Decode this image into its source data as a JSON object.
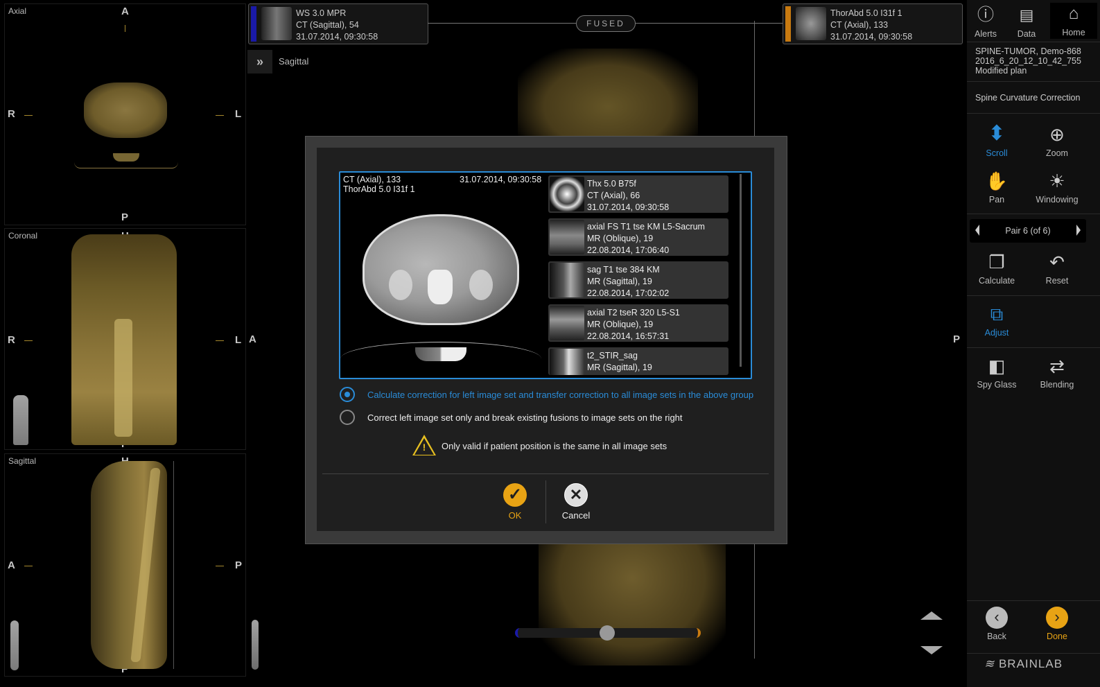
{
  "left_views": {
    "axial": {
      "title": "Axial",
      "top": "A",
      "bottom": "P",
      "left": "R",
      "right": "L"
    },
    "coronal": {
      "title": "Coronal",
      "top": "H",
      "bottom": "F",
      "left": "R",
      "right": "L"
    },
    "sagittal": {
      "title": "Sagittal",
      "top": "H",
      "bottom": "F",
      "left": "A",
      "right": "P"
    }
  },
  "center": {
    "left_series": {
      "line1": "WS 3.0 MPR",
      "line2": "CT (Sagittal), 54",
      "line3": "31.07.2014, 09:30:58",
      "stripe_color": "#1a1aa8"
    },
    "right_series": {
      "line1": "ThorAbd 5.0 I31f 1",
      "line2": "CT (Axial), 133",
      "line3": "31.07.2014, 09:30:58",
      "stripe_color": "#c87a10"
    },
    "fused_label": "FUSED",
    "view_label": "Sagittal",
    "left_ori": "A",
    "right_ori": "P"
  },
  "right_panel": {
    "top_buttons": [
      {
        "label": "Alerts",
        "icon": "info-icon"
      },
      {
        "label": "Data",
        "icon": "data-icon"
      },
      {
        "label": "Home",
        "icon": "home-icon"
      }
    ],
    "patient": {
      "line1": "SPINE-TUMOR, Demo-868",
      "line2": "2016_6_20_12_10_42_755",
      "line3": "Modified plan"
    },
    "section_title": "Spine Curvature Correction",
    "tools": [
      {
        "label": "Scroll",
        "icon": "scroll-icon",
        "active": true
      },
      {
        "label": "Zoom",
        "icon": "zoom-icon"
      },
      {
        "label": "Pan",
        "icon": "pan-hand-icon"
      },
      {
        "label": "Windowing",
        "icon": "windowing-icon"
      }
    ],
    "pair_label": "Pair 6 (of 6)",
    "actions": [
      {
        "label": "Calculate",
        "icon": "calculate-icon"
      },
      {
        "label": "Reset",
        "icon": "reset-icon"
      },
      {
        "label": "Adjust",
        "icon": "adjust-icon",
        "active": true
      },
      {
        "label": "Spy Glass",
        "icon": "spy-glass-icon"
      },
      {
        "label": "Blending",
        "icon": "blending-icon"
      }
    ],
    "back_label": "Back",
    "done_label": "Done",
    "brand": "BRAINLAB",
    "accent_color": "#2a8cd8",
    "done_color": "#e8a314"
  },
  "dialog": {
    "preview_header_left1": "CT (Axial), 133",
    "preview_header_left2": "ThorAbd 5.0 I31f 1",
    "preview_header_right": "31.07.2014, 09:30:58",
    "series_list": [
      {
        "l1": "Thx 5.0 B75f",
        "l2": "CT (Axial), 66",
        "l3": "31.07.2014, 09:30:58"
      },
      {
        "l1": "axial FS T1 tse KM L5-Sacrum",
        "l2": "MR (Oblique), 19",
        "l3": "22.08.2014, 17:06:40"
      },
      {
        "l1": "sag T1 tse 384 KM",
        "l2": "MR (Sagittal), 19",
        "l3": "22.08.2014, 17:02:02"
      },
      {
        "l1": "axial T2 tseR 320 L5-S1",
        "l2": "MR (Oblique), 19",
        "l3": "22.08.2014, 16:57:31"
      },
      {
        "l1": "t2_STIR_sag",
        "l2": "MR (Sagittal), 19",
        "l3": ""
      }
    ],
    "option1": "Calculate correction for left image set and transfer correction to all image sets in the above group",
    "option2": "Correct left image set only and break existing fusions to image sets on the right",
    "warning": "Only valid if patient position is the same in all image sets",
    "ok_label": "OK",
    "cancel_label": "Cancel"
  }
}
